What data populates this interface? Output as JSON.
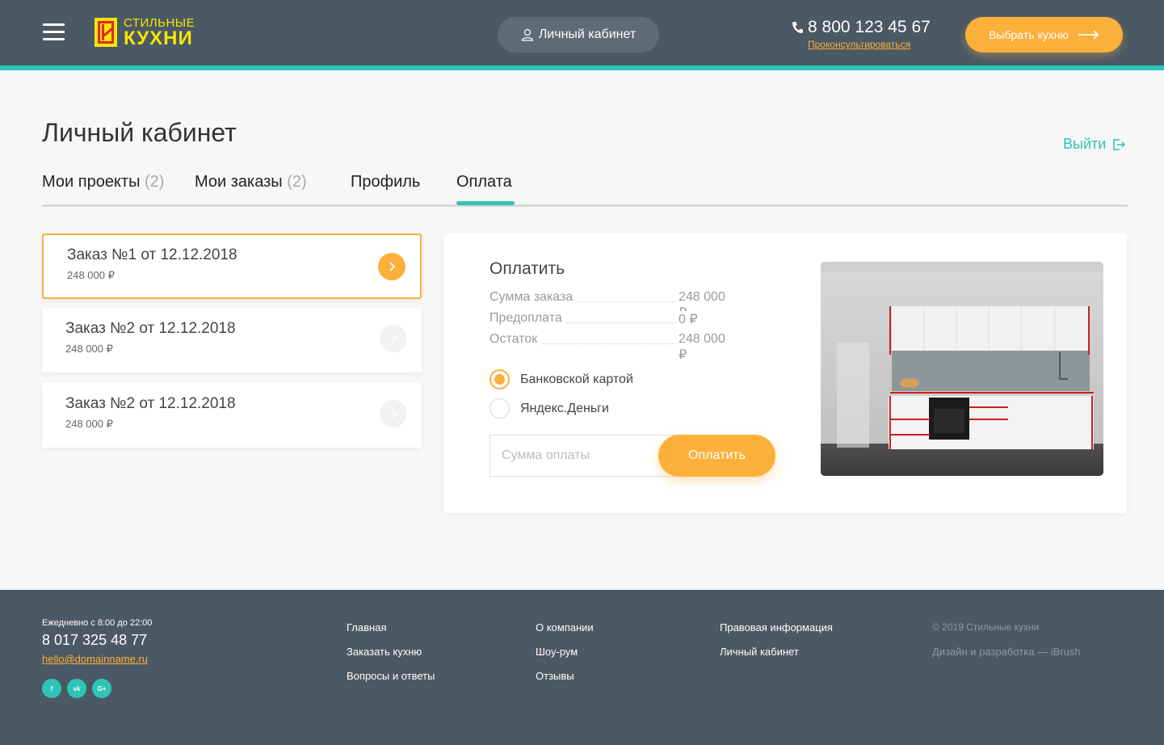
{
  "header": {
    "logo_line1": "СТИЛЬНЫЕ",
    "logo_line2": "КУХНИ",
    "cabinet_label": "Личный кабинет",
    "phone": "8 800 123 45 67",
    "consult_label": "Проконсультироваться",
    "choose_label": "Выбрать кухню"
  },
  "page": {
    "title": "Личный кабинет",
    "logout_label": "Выйти"
  },
  "tabs": [
    {
      "label": "Мои проекты",
      "count": "(2)"
    },
    {
      "label": "Мои заказы",
      "count": "(2)"
    },
    {
      "label": "Профиль",
      "count": ""
    },
    {
      "label": "Оплата",
      "count": ""
    }
  ],
  "active_tab": "Оплата",
  "orders": [
    {
      "title": "Заказ №1  от 12.12.2018",
      "sum": "248 000 ₽",
      "active": true
    },
    {
      "title": "Заказ №2  от 12.12.2018",
      "sum": "248 000 ₽",
      "active": false
    },
    {
      "title": "Заказ №2  от 12.12.2018",
      "sum": "248 000 ₽",
      "active": false
    }
  ],
  "payment": {
    "title": "Оплатить",
    "rows": [
      {
        "label": "Сумма заказа",
        "value": "248 000 ₽"
      },
      {
        "label": "Предоплата",
        "value": "0 ₽"
      },
      {
        "label": "Остаток",
        "value": "248 000 ₽"
      }
    ],
    "methods": [
      {
        "label": "Банковской картой",
        "checked": true
      },
      {
        "label": "Яндекс.Деньги",
        "checked": false
      }
    ],
    "amount_placeholder": "Сумма оплаты",
    "pay_label": "Оплатить"
  },
  "footer": {
    "hours": "Ежедневно с 8:00 до 22:00",
    "phone": "8 017 325 48 77",
    "email": "hello@domainname.ru",
    "socials": [
      "f",
      "vk",
      "G+"
    ],
    "links": {
      "col1": [
        "Главная",
        "Заказать кухню",
        "Вопросы и ответы"
      ],
      "col2": [
        "О компании",
        "Шоу-рум",
        "Отзывы"
      ],
      "col3": [
        "Правовая информация",
        "Личный кабинет"
      ]
    },
    "copyright": "© 2019 Стильные кухни",
    "developer": "Дизайн и разработка — iBrush"
  },
  "colors": {
    "header_bg": "#4b5865",
    "accent_teal": "#2ec4b6",
    "accent_orange": "#fbb03b",
    "logo_yellow": "#f6e600"
  }
}
